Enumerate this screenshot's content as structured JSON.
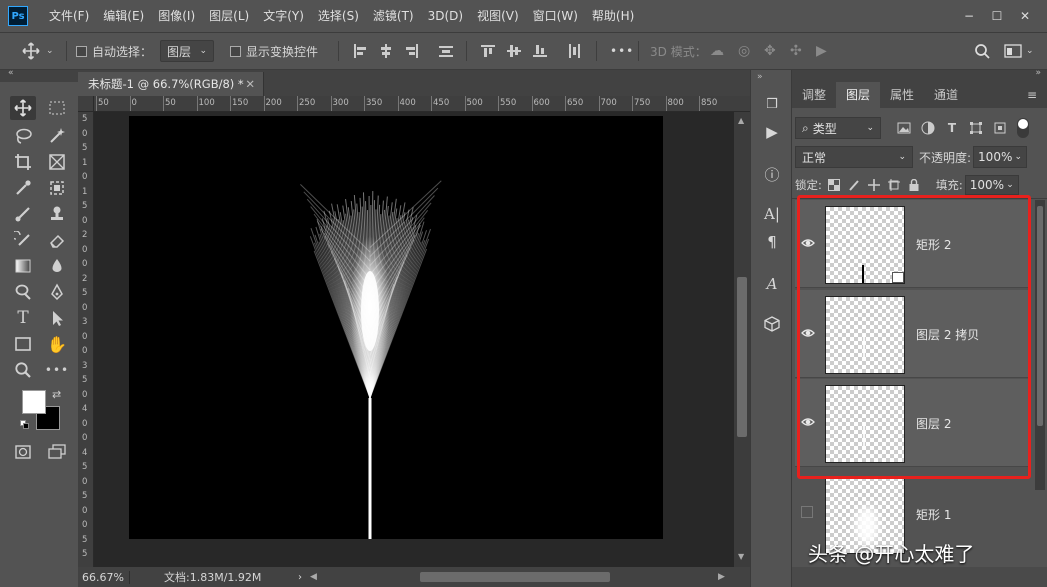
{
  "app": {
    "logo": "Ps"
  },
  "menu": [
    "文件(F)",
    "编辑(E)",
    "图像(I)",
    "图层(L)",
    "文字(Y)",
    "选择(S)",
    "滤镜(T)",
    "3D(D)",
    "视图(V)",
    "窗口(W)",
    "帮助(H)"
  ],
  "window_controls": {
    "minimize": "−",
    "maximize": "☐",
    "close": "✕"
  },
  "options": {
    "auto_select_label": "自动选择：",
    "auto_select_value": "图层",
    "show_transform_label": "显示变换控件",
    "more": "•••",
    "mode_3d_label": "3D 模式："
  },
  "document": {
    "tab_title": "未标题-1 @ 66.7%(RGB/8) *",
    "zoom": "66.67%",
    "doc_info": "文档:1.83M/1.92M",
    "ruler_h_ticks": [
      "50",
      "0",
      "50",
      "100",
      "150",
      "200",
      "250",
      "300",
      "350",
      "400",
      "450",
      "500",
      "550",
      "600",
      "650",
      "700",
      "750",
      "800",
      "850"
    ],
    "ruler_v_ticks": [
      "5",
      "0",
      "5",
      "1",
      "0",
      "1",
      "5",
      "0",
      "2",
      "0",
      "0",
      "2",
      "5",
      "0",
      "3",
      "0",
      "0",
      "3",
      "5",
      "0",
      "4",
      "0",
      "0",
      "4",
      "5",
      "0",
      "5",
      "0",
      "0",
      "5",
      "5"
    ]
  },
  "layers_panel": {
    "tabs": [
      "调整",
      "图层",
      "属性",
      "通道"
    ],
    "active_tab": "图层",
    "filter_label": "类型",
    "blend_mode": "正常",
    "opacity_label": "不透明度:",
    "opacity_value": "100%",
    "lock_label": "锁定:",
    "fill_label": "填充:",
    "fill_value": "100%",
    "layers": [
      {
        "name": "矩形 2",
        "visible": true
      },
      {
        "name": "图层 2 拷贝",
        "visible": true
      },
      {
        "name": "图层 2",
        "visible": true
      },
      {
        "name": "矩形 1",
        "visible": false
      }
    ]
  },
  "watermark": "头条 @开心太难了",
  "colors": {
    "highlight_box": "#e8211d",
    "panel_bg": "#535353",
    "canvas_bg": "#000000"
  }
}
